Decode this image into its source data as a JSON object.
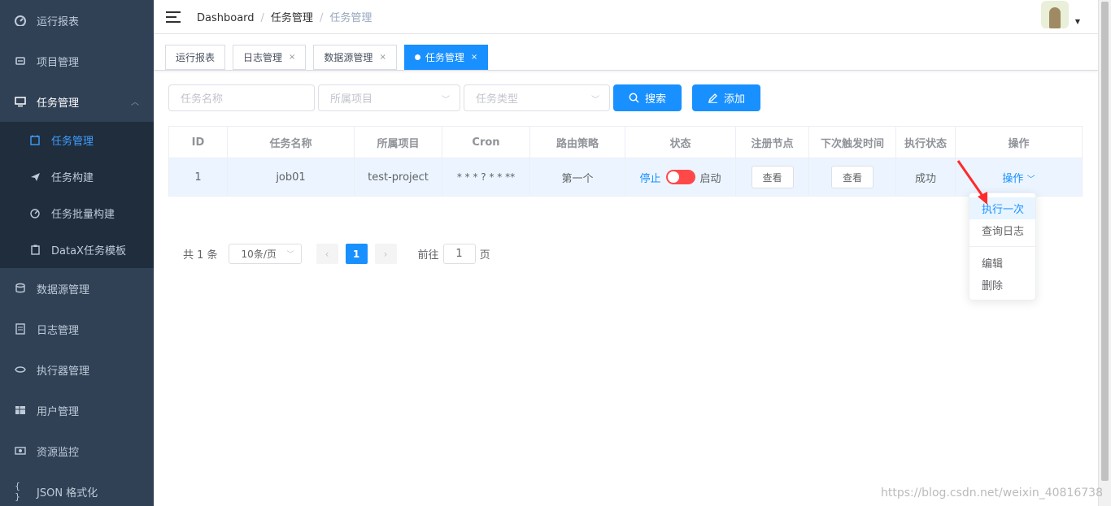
{
  "sidebar": {
    "items": [
      {
        "label": "运行报表",
        "icon": "dashboard-icon"
      },
      {
        "label": "项目管理",
        "icon": "project-icon"
      },
      {
        "label": "任务管理",
        "icon": "monitor-icon"
      },
      {
        "label": "数据源管理",
        "icon": "database-icon"
      },
      {
        "label": "日志管理",
        "icon": "log-icon"
      },
      {
        "label": "执行器管理",
        "icon": "executor-icon"
      },
      {
        "label": "用户管理",
        "icon": "user-table-icon"
      },
      {
        "label": "资源监控",
        "icon": "monitor-resource-icon"
      },
      {
        "label": "JSON 格式化",
        "icon": "braces-icon"
      }
    ],
    "submenu": [
      {
        "label": "任务管理",
        "icon": "calendar-icon",
        "active": true
      },
      {
        "label": "任务构建",
        "icon": "paper-plane-icon"
      },
      {
        "label": "任务批量构建",
        "icon": "gauge-icon"
      },
      {
        "label": "DataX任务模板",
        "icon": "clipboard-icon"
      }
    ]
  },
  "breadcrumb": [
    "Dashboard",
    "任务管理",
    "任务管理"
  ],
  "tags": [
    {
      "label": "运行报表",
      "closable": false,
      "active": false
    },
    {
      "label": "日志管理",
      "closable": true,
      "active": false
    },
    {
      "label": "数据源管理",
      "closable": true,
      "active": false
    },
    {
      "label": "任务管理",
      "closable": true,
      "active": true
    }
  ],
  "tag_close": "×",
  "filters": {
    "task_name_placeholder": "任务名称",
    "project_placeholder": "所属项目",
    "type_placeholder": "任务类型",
    "search_label": "搜索",
    "add_label": "添加"
  },
  "table": {
    "headers": [
      "ID",
      "任务名称",
      "所属项目",
      "Cron",
      "路由策略",
      "状态",
      "注册节点",
      "下次触发时间",
      "执行状态",
      "操作"
    ],
    "row": {
      "id": "1",
      "name": "job01",
      "project": "test-project",
      "cron": "* * * ? * * **",
      "route": "第一个",
      "status_off": "停止",
      "status_on": "启动",
      "nodes_btn": "查看",
      "next_btn": "查看",
      "exec_status": "成功",
      "op": "操作"
    }
  },
  "pagination": {
    "total": "共 1 条",
    "page_size": "10条/页",
    "current": "1",
    "goto_label": "前往",
    "goto_value": "1",
    "page_suffix": "页"
  },
  "dropdown": [
    "执行一次",
    "查询日志",
    "编辑",
    "删除"
  ],
  "watermark": "https://blog.csdn.net/weixin_40816738",
  "colors": {
    "primary": "#1890ff",
    "sidebar": "#304156",
    "submenu": "#1f2d3d",
    "arrow": "#ff2a2a"
  }
}
